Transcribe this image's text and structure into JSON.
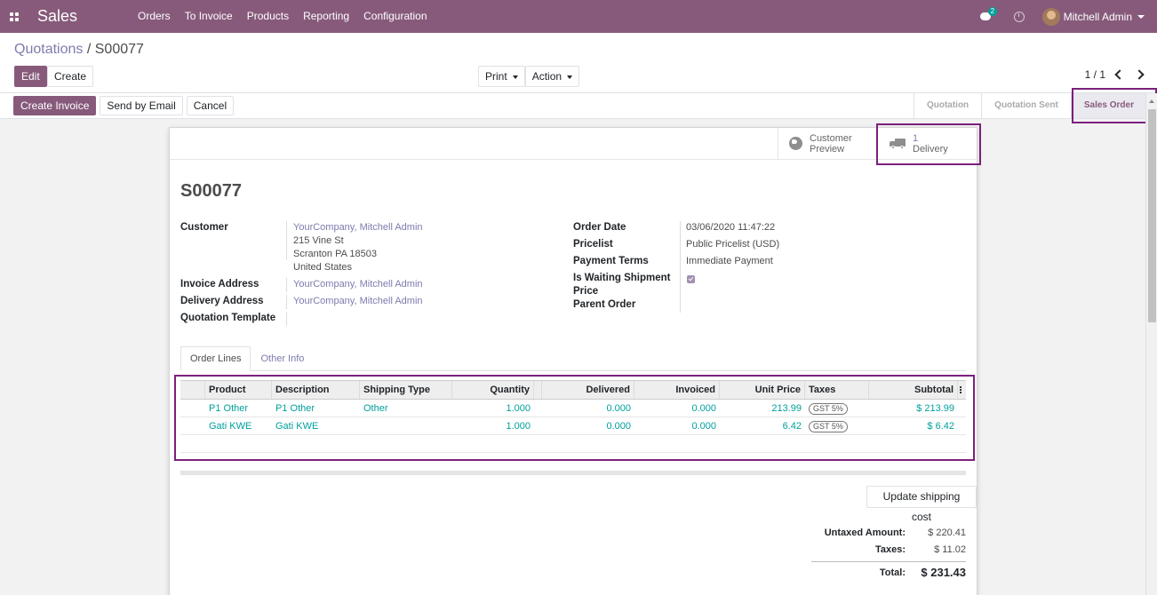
{
  "navbar": {
    "app_name": "Sales",
    "menu": [
      "Orders",
      "To Invoice",
      "Products",
      "Reporting",
      "Configuration"
    ],
    "chat_count": "2",
    "user_name": "Mitchell Admin",
    "color": "#875a7b"
  },
  "breadcrumb": {
    "parent": "Quotations",
    "separator": "/",
    "current": "S00077"
  },
  "toolbar": {
    "edit_label": "Edit",
    "create_label": "Create",
    "print_label": "Print",
    "action_label": "Action",
    "pager": "1 / 1"
  },
  "statusbar": {
    "create_invoice_label": "Create Invoice",
    "send_email_label": "Send by Email",
    "cancel_label": "Cancel",
    "stages": [
      "Quotation",
      "Quotation Sent",
      "Sales Order"
    ],
    "active_stage": "Sales Order"
  },
  "smart_buttons": {
    "preview_line1": "Customer",
    "preview_line2": "Preview",
    "delivery_count": "1",
    "delivery_label": "Delivery"
  },
  "form": {
    "title": "S00077",
    "customer_label": "Customer",
    "customer_name": "YourCompany, Mitchell Admin",
    "customer_street": "215 Vine St",
    "customer_city": "Scranton PA 18503",
    "customer_country": "United States",
    "invoice_address_label": "Invoice Address",
    "invoice_address": "YourCompany, Mitchell Admin",
    "delivery_address_label": "Delivery Address",
    "delivery_address": "YourCompany, Mitchell Admin",
    "quotation_template_label": "Quotation Template",
    "order_date_label": "Order Date",
    "order_date": "03/06/2020 11:47:22",
    "pricelist_label": "Pricelist",
    "pricelist": "Public Pricelist (USD)",
    "payment_terms_label": "Payment Terms",
    "payment_terms": "Immediate Payment",
    "waiting_shipment_label_1": "Is Waiting Shipment",
    "waiting_shipment_label_2": "Price",
    "waiting_shipment_checked": true,
    "parent_order_label": "Parent Order"
  },
  "tabs": [
    "Order Lines",
    "Other Info"
  ],
  "order_lines": {
    "columns": [
      "Product",
      "Description",
      "Shipping Type",
      "Quantity",
      "Delivered",
      "Invoiced",
      "Unit Price",
      "Taxes",
      "Subtotal"
    ],
    "rows": [
      {
        "product": "P1 Other",
        "description": "P1 Other",
        "shipping_type": "Other",
        "quantity": "1.000",
        "delivered": "0.000",
        "invoiced": "0.000",
        "unit_price": "213.99",
        "taxes": "GST 5%",
        "subtotal": "$ 213.99"
      },
      {
        "product": "Gati KWE",
        "description": "Gati KWE",
        "shipping_type": "",
        "quantity": "1.000",
        "delivered": "0.000",
        "invoiced": "0.000",
        "unit_price": "6.42",
        "taxes": "GST 5%",
        "subtotal": "$ 6.42"
      }
    ]
  },
  "update_shipping_label": "Update shipping cost",
  "totals": {
    "untaxed_label": "Untaxed Amount:",
    "untaxed_value": "$ 220.41",
    "taxes_label": "Taxes:",
    "taxes_value": "$ 11.02",
    "total_label": "Total:",
    "total_value": "$ 231.43"
  },
  "highlight_color": "#7c1f7c"
}
